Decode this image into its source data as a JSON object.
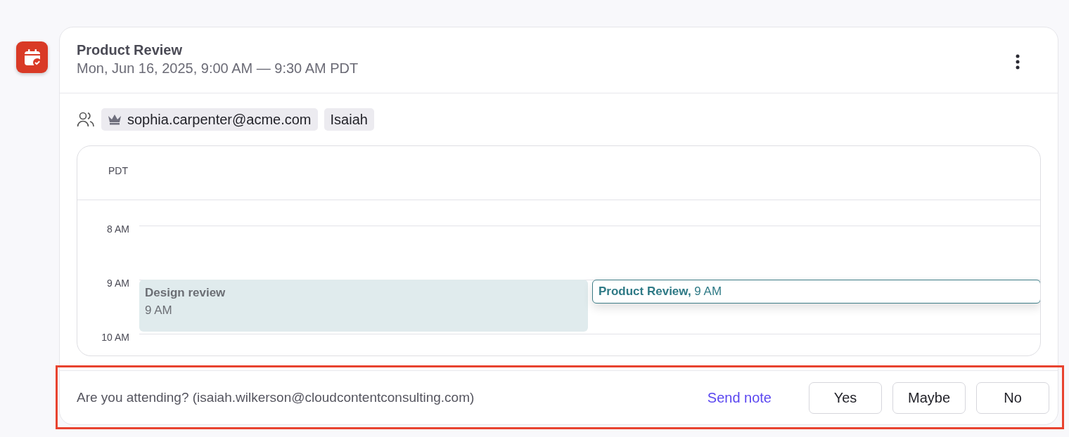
{
  "event": {
    "title": "Product Review",
    "when": "Mon, Jun 16, 2025, 9:00 AM — 9:30 AM PDT"
  },
  "attendees": [
    {
      "name": "sophia.carpenter@acme.com",
      "organizer": true
    },
    {
      "name": "Isaiah",
      "organizer": false
    }
  ],
  "calendar": {
    "timezone": "PDT",
    "hours": [
      "8 AM",
      "9 AM",
      "10 AM"
    ],
    "events": [
      {
        "kind": "busy",
        "title": "Design review",
        "time": "9 AM"
      },
      {
        "kind": "current",
        "title": "Product Review,",
        "time": "9 AM"
      }
    ]
  },
  "rsvp": {
    "highlighted": true,
    "question": "Are you attending?",
    "email": "(isaiah.wilkerson@cloudcontentconsulting.com)",
    "send_note": "Send note",
    "options": [
      {
        "label": "Yes",
        "selected": false
      },
      {
        "label": "Maybe",
        "selected": false
      },
      {
        "label": "No",
        "selected": false
      }
    ]
  }
}
